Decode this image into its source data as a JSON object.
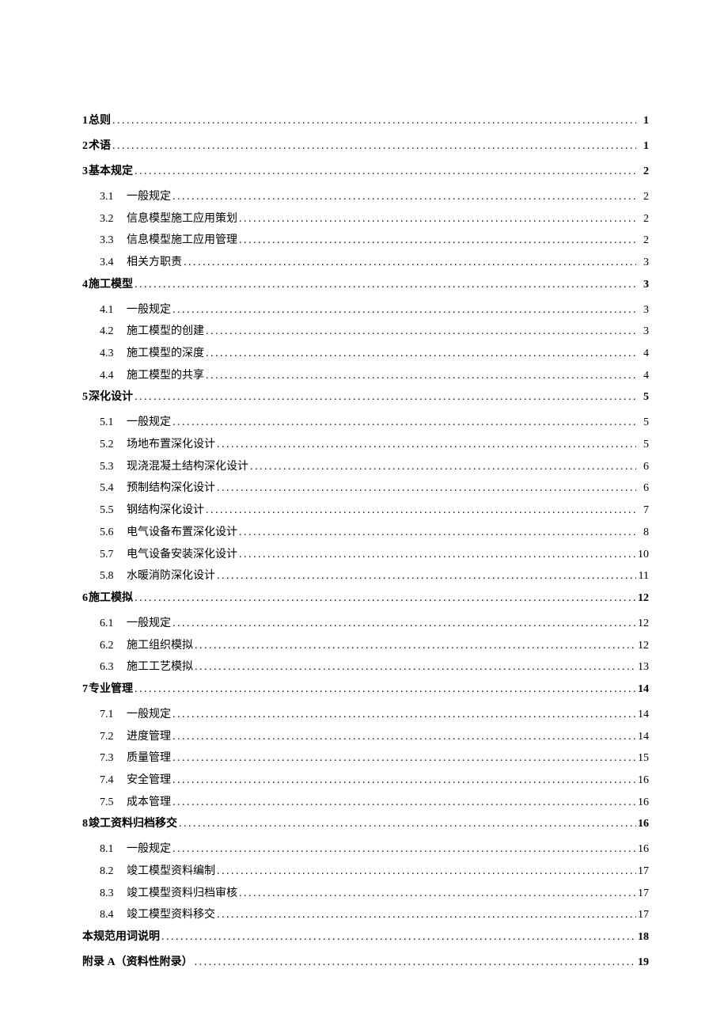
{
  "toc": [
    {
      "level": 1,
      "num": "1",
      "title": "总则",
      "page": "1"
    },
    {
      "level": 1,
      "num": "2",
      "title": "术语",
      "page": "1"
    },
    {
      "level": 1,
      "num": "3",
      "title": "基本规定",
      "page": "2"
    },
    {
      "level": 2,
      "num": "3.1",
      "title": "一般规定",
      "page": "2"
    },
    {
      "level": 2,
      "num": "3.2",
      "title": "信息模型施工应用策划",
      "page": "2"
    },
    {
      "level": 2,
      "num": "3.3",
      "title": "信息模型施工应用管理",
      "page": "2"
    },
    {
      "level": 2,
      "num": "3.4",
      "title": "相关方职责",
      "page": "3"
    },
    {
      "level": 1,
      "num": "4",
      "title": "施工模型",
      "page": "3"
    },
    {
      "level": 2,
      "num": "4.1",
      "title": "一般规定",
      "page": "3"
    },
    {
      "level": 2,
      "num": "4.2",
      "title": "施工模型的创建",
      "page": "3"
    },
    {
      "level": 2,
      "num": "4.3",
      "title": "施工模型的深度",
      "page": "4"
    },
    {
      "level": 2,
      "num": "4.4",
      "title": "施工模型的共享",
      "page": "4"
    },
    {
      "level": 1,
      "num": "5",
      "title": "深化设计",
      "page": "5"
    },
    {
      "level": 2,
      "num": "5.1",
      "title": "一般规定",
      "page": "5"
    },
    {
      "level": 2,
      "num": "5.2",
      "title": "场地布置深化设计",
      "page": "5"
    },
    {
      "level": 2,
      "num": "5.3",
      "title": "现浇混凝土结构深化设计",
      "page": "6"
    },
    {
      "level": 2,
      "num": "5.4",
      "title": "预制结构深化设计",
      "page": "6"
    },
    {
      "level": 2,
      "num": "5.5",
      "title": "钢结构深化设计",
      "page": "7"
    },
    {
      "level": 2,
      "num": "5.6",
      "title": "电气设备布置深化设计",
      "page": "8"
    },
    {
      "level": 2,
      "num": "5.7",
      "title": "电气设备安装深化设计",
      "page": "10"
    },
    {
      "level": 2,
      "num": "5.8",
      "title": "水暖消防深化设计",
      "page": "11"
    },
    {
      "level": 1,
      "num": "6",
      "title": "施工模拟",
      "page": "12"
    },
    {
      "level": 2,
      "num": "6.1",
      "title": "一般规定",
      "page": "12"
    },
    {
      "level": 2,
      "num": "6.2",
      "title": "施工组织模拟",
      "page": "12"
    },
    {
      "level": 2,
      "num": "6.3",
      "title": "施工工艺模拟",
      "page": "13"
    },
    {
      "level": 1,
      "num": "7",
      "title": "专业管理",
      "page": "14"
    },
    {
      "level": 2,
      "num": "7.1",
      "title": "一般规定",
      "page": "14"
    },
    {
      "level": 2,
      "num": "7.2",
      "title": "进度管理",
      "page": "14"
    },
    {
      "level": 2,
      "num": "7.3",
      "title": "质量管理",
      "page": "15"
    },
    {
      "level": 2,
      "num": "7.4",
      "title": "安全管理",
      "page": "16"
    },
    {
      "level": 2,
      "num": "7.5",
      "title": "成本管理",
      "page": "16"
    },
    {
      "level": 1,
      "num": "8",
      "title": "竣工资料归档移交",
      "page": "16"
    },
    {
      "level": 2,
      "num": "8.1",
      "title": "一般规定",
      "page": "16"
    },
    {
      "level": 2,
      "num": "8.2",
      "title": "竣工模型资料编制",
      "page": "17"
    },
    {
      "level": 2,
      "num": "8.3",
      "title": "竣工模型资料归档审核",
      "page": "17"
    },
    {
      "level": 2,
      "num": "8.4",
      "title": "竣工模型资料移交",
      "page": "17"
    },
    {
      "level": 1,
      "num": "",
      "title": "本规范用词说明",
      "page": "18"
    },
    {
      "level": 1,
      "num": "",
      "title": "附录 A（资料性附录）",
      "page": "19"
    }
  ]
}
